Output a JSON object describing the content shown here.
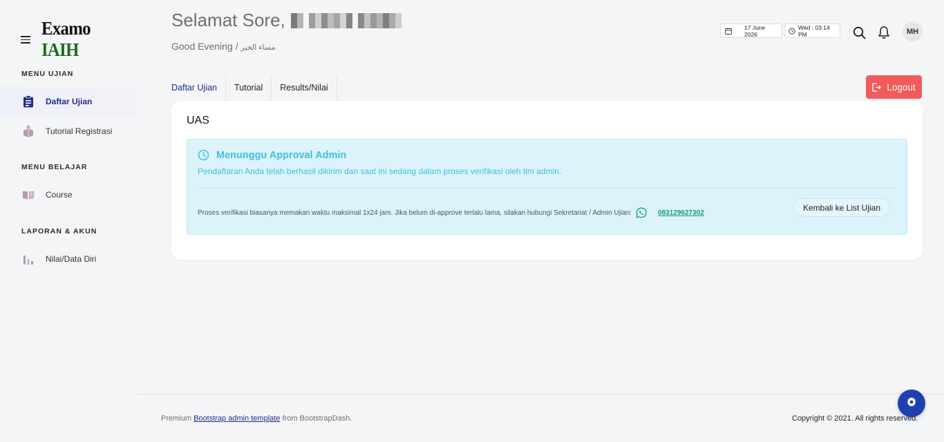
{
  "brand": {
    "logo_part1": "Examo",
    "logo_part2": "IAIH"
  },
  "sidebar": {
    "sections": [
      {
        "title": "MENU UJIAN",
        "items": [
          {
            "label": "Daftar Ujian",
            "icon": "clipboard-icon",
            "active": true
          },
          {
            "label": "Tutorial Registrasi",
            "icon": "box-icon",
            "active": false
          }
        ]
      },
      {
        "title": "MENU BELAJAR",
        "items": [
          {
            "label": "Course",
            "icon": "book-icon",
            "active": false
          }
        ]
      },
      {
        "title": "LAPORAN & AKUN",
        "items": [
          {
            "label": "Nilai/Data Diri",
            "icon": "bar-chart-icon",
            "active": false
          }
        ]
      }
    ]
  },
  "header": {
    "greeting": "Selamat Sore,",
    "subtitle_en": "Good Evening /",
    "subtitle_ar": "مساء الخير",
    "date": "17 June 2026",
    "time": "Wed : 03:14 PM",
    "avatar_initials": "MH"
  },
  "tabs": [
    {
      "label": "Daftar Ujian",
      "active": true
    },
    {
      "label": "Tutorial",
      "active": false
    },
    {
      "label": "Results/Nilai",
      "active": false
    }
  ],
  "logout_label": "Logout",
  "card": {
    "title": "UAS",
    "alert": {
      "heading": "Menunggu Approval Admin",
      "message": "Pendaftaran Anda telah berhasil dikirim dan saat ini sedang dalam proses verifikasi oleh tim admin.",
      "note": "Proses verifikasi biasanya memakan waktu maksimal 1x24 jam. Jika belum di-approve terlalu lama, silakan hubungi Sekretariat / Admin Ujian:",
      "phone": "083129627302",
      "back_button": "Kembali ke List Ujian"
    }
  },
  "footer": {
    "left_prefix": "Premium",
    "left_link": "Bootstrap admin template",
    "left_suffix": "from BootstrapDash.",
    "right": "Copyright © 2021. All rights reserved."
  },
  "colors": {
    "accent": "#1f2e86",
    "logout": "#f15b5b",
    "info": "#3ec0de",
    "fab": "#1f3fb0"
  }
}
